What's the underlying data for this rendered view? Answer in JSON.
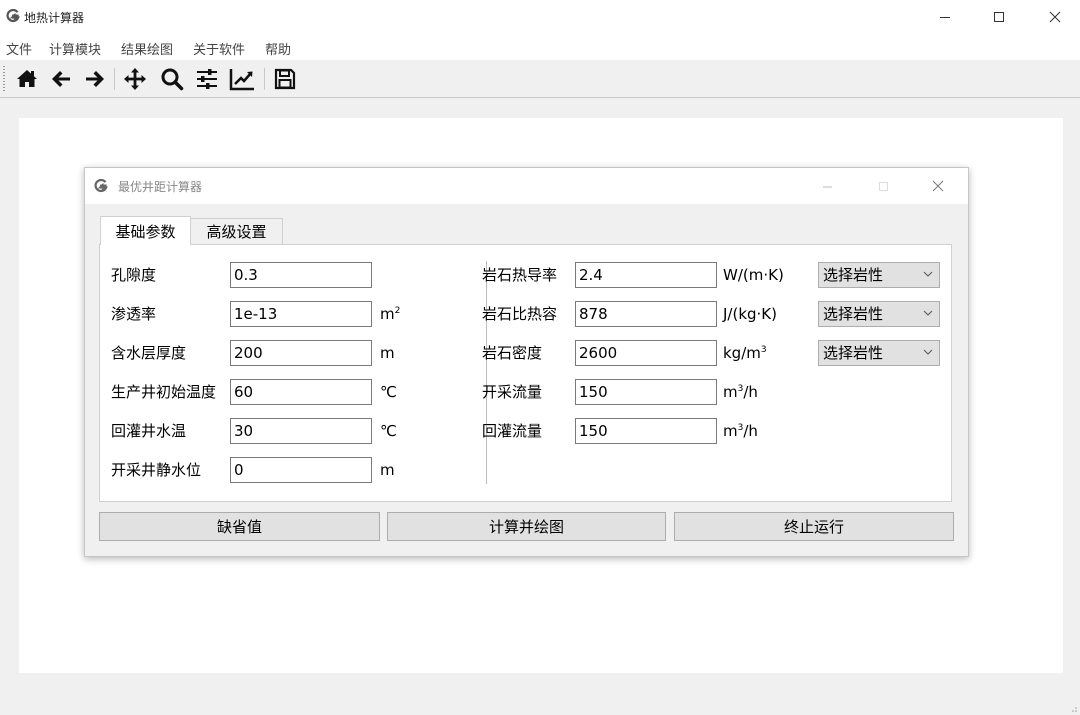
{
  "window": {
    "title": "地热计算器",
    "menu": [
      "文件",
      "计算模块",
      "结果绘图",
      "关于软件",
      "帮助"
    ]
  },
  "toolbar": {
    "icons": [
      "home-icon",
      "back-arrow-icon",
      "forward-arrow-icon",
      "pan-icon",
      "zoom-icon",
      "configure-subplots-icon",
      "axes-edit-icon",
      "save-icon"
    ]
  },
  "dialog": {
    "title": "最优井距计算器",
    "tabs": [
      "基础参数",
      "高级设置"
    ],
    "left_params": [
      {
        "label": "孔隙度",
        "value": "0.3",
        "unit": ""
      },
      {
        "label": "渗透率",
        "value": "1e-13",
        "unit": "m",
        "unit_sup": "2"
      },
      {
        "label": "含水层厚度",
        "value": "200",
        "unit": "m"
      },
      {
        "label": "生产井初始温度",
        "value": "60",
        "unit": "℃"
      },
      {
        "label": "回灌井水温",
        "value": "30",
        "unit": "℃"
      },
      {
        "label": "开采井静水位",
        "value": "0",
        "unit": "m"
      }
    ],
    "right_params": [
      {
        "label": "岩石热导率",
        "value": "2.4",
        "unit": "W/(m·K)",
        "combo": "选择岩性"
      },
      {
        "label": "岩石比热容",
        "value": "878",
        "unit": "J/(kg·K)",
        "combo": "选择岩性"
      },
      {
        "label": "岩石密度",
        "value": "2600",
        "unit_pre": "kg/m",
        "unit_sup": "3",
        "combo": "选择岩性"
      },
      {
        "label": "开采流量",
        "value": "150",
        "unit_pre": "m",
        "unit_sup": "3",
        "unit_post": "/h"
      },
      {
        "label": "回灌流量",
        "value": "150",
        "unit_pre": "m",
        "unit_sup": "3",
        "unit_post": "/h"
      }
    ],
    "buttons": {
      "defaults": "缺省值",
      "calculate": "计算并绘图",
      "stop": "终止运行"
    }
  },
  "colors": {
    "logo": "#5a5a5a",
    "window_bg": "#f0f0f0",
    "button_bg": "#e1e1e1"
  }
}
